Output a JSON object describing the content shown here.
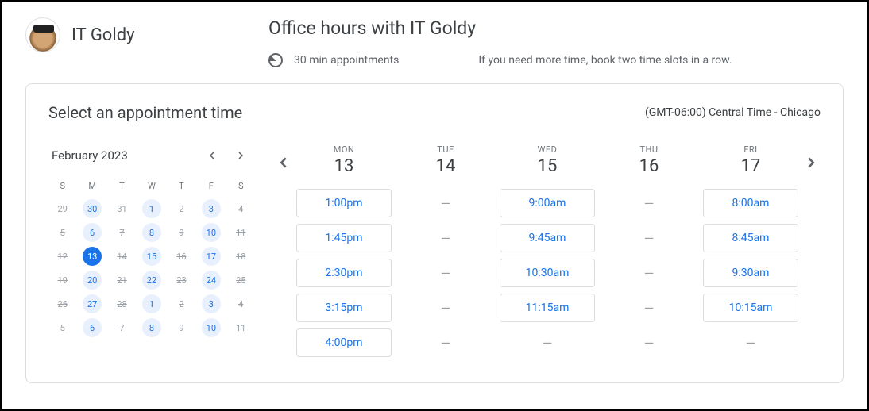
{
  "profile": {
    "name": "IT Goldy"
  },
  "page": {
    "title": "Office hours with IT Goldy",
    "duration": "30 min appointments",
    "note": "If you need more time, book two time slots in a row."
  },
  "card": {
    "title": "Select an appointment time",
    "timezone": "(GMT-06:00) Central Time - Chicago"
  },
  "calendar": {
    "month": "February 2023",
    "dow": [
      "S",
      "M",
      "T",
      "W",
      "T",
      "F",
      "S"
    ],
    "cells": [
      {
        "n": "29",
        "s": "unavail"
      },
      {
        "n": "30",
        "s": "avail"
      },
      {
        "n": "31",
        "s": "unavail"
      },
      {
        "n": "1",
        "s": "avail"
      },
      {
        "n": "2",
        "s": "unavail"
      },
      {
        "n": "3",
        "s": "avail"
      },
      {
        "n": "4",
        "s": "unavail"
      },
      {
        "n": "5",
        "s": "unavail"
      },
      {
        "n": "6",
        "s": "avail"
      },
      {
        "n": "7",
        "s": "unavail"
      },
      {
        "n": "8",
        "s": "avail"
      },
      {
        "n": "9",
        "s": "unavail"
      },
      {
        "n": "10",
        "s": "avail"
      },
      {
        "n": "11",
        "s": "unavail"
      },
      {
        "n": "12",
        "s": "unavail"
      },
      {
        "n": "13",
        "s": "selected"
      },
      {
        "n": "14",
        "s": "unavail"
      },
      {
        "n": "15",
        "s": "avail"
      },
      {
        "n": "16",
        "s": "unavail"
      },
      {
        "n": "17",
        "s": "avail"
      },
      {
        "n": "18",
        "s": "unavail"
      },
      {
        "n": "19",
        "s": "unavail"
      },
      {
        "n": "20",
        "s": "avail"
      },
      {
        "n": "21",
        "s": "unavail"
      },
      {
        "n": "22",
        "s": "avail"
      },
      {
        "n": "23",
        "s": "unavail"
      },
      {
        "n": "24",
        "s": "avail"
      },
      {
        "n": "25",
        "s": "unavail"
      },
      {
        "n": "26",
        "s": "unavail"
      },
      {
        "n": "27",
        "s": "avail"
      },
      {
        "n": "28",
        "s": "unavail"
      },
      {
        "n": "1",
        "s": "avail"
      },
      {
        "n": "2",
        "s": "unavail"
      },
      {
        "n": "3",
        "s": "avail"
      },
      {
        "n": "4",
        "s": "unavail"
      },
      {
        "n": "5",
        "s": "unavail"
      },
      {
        "n": "6",
        "s": "avail"
      },
      {
        "n": "7",
        "s": "unavail"
      },
      {
        "n": "8",
        "s": "avail"
      },
      {
        "n": "9",
        "s": "unavail"
      },
      {
        "n": "10",
        "s": "avail"
      },
      {
        "n": "11",
        "s": "unavail"
      }
    ]
  },
  "days": [
    {
      "dow": "MON",
      "num": "13",
      "slots": [
        "1:00pm",
        "1:45pm",
        "2:30pm",
        "3:15pm",
        "4:00pm"
      ]
    },
    {
      "dow": "TUE",
      "num": "14",
      "slots": [
        null,
        null,
        null,
        null,
        null
      ]
    },
    {
      "dow": "WED",
      "num": "15",
      "slots": [
        "9:00am",
        "9:45am",
        "10:30am",
        "11:15am",
        null
      ]
    },
    {
      "dow": "THU",
      "num": "16",
      "slots": [
        null,
        null,
        null,
        null,
        null
      ]
    },
    {
      "dow": "FRI",
      "num": "17",
      "slots": [
        "8:00am",
        "8:45am",
        "9:30am",
        "10:15am",
        null
      ]
    }
  ]
}
